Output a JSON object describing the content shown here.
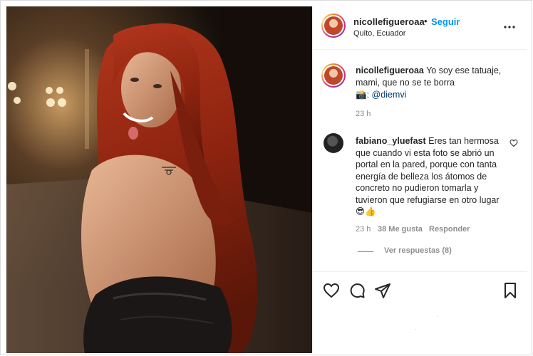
{
  "post": {
    "username": "nicollefigueroaa",
    "separator": "•",
    "follow_label": "Seguir",
    "location": "Quito, Ecuador"
  },
  "caption": {
    "username": "nicollefigueroaa",
    "text": "Yo soy ese tatuaje, mami, que no se te borra",
    "camera_emoji": "📸",
    "credit_suffix": ":",
    "mention": "@diemvi",
    "time": "23 h"
  },
  "comment": {
    "username": "fabiano_yluefast",
    "text": "Eres tan hermosa que cuando vi esta foto se abrió un portal en la pared, porque con tanta energía de belleza los átomos de concreto no pudieron tomarla y tuvieron que refugiarse en otro lugar",
    "emojis": "😎👍",
    "time": "23 h",
    "likes": "38 Me gusta",
    "reply_label": "Responder",
    "view_replies": "Ver respuestas (8)"
  },
  "icons": {
    "more": "more-options-icon",
    "like": "heart-icon",
    "comment": "comment-icon",
    "share": "share-icon",
    "save": "bookmark-icon"
  },
  "colors": {
    "accent": "#0095f6",
    "muted": "#8e8e8e",
    "text": "#262626",
    "mention": "#00376b"
  }
}
